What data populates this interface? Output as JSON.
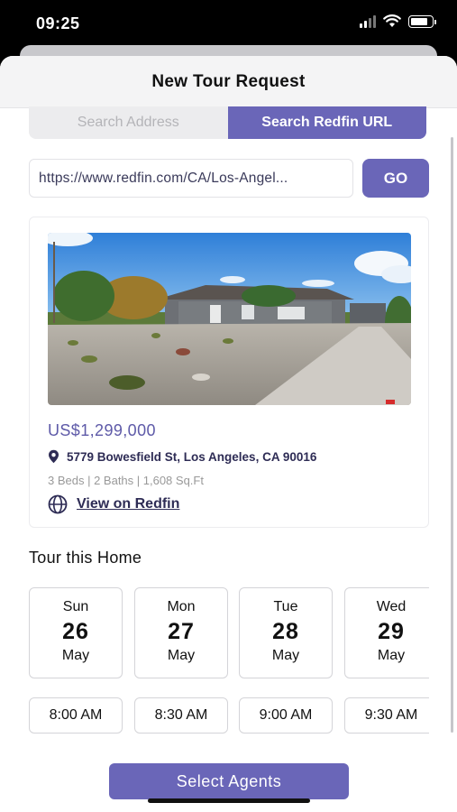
{
  "status_bar": {
    "time": "09:25"
  },
  "header": {
    "title": "New Tour Request"
  },
  "search_tabs": {
    "address_label": "Search Address",
    "redfin_label": "Search Redfin URL",
    "active": "redfin"
  },
  "url_input": {
    "value": "https://www.redfin.com/CA/Los-Angel..."
  },
  "go_button": {
    "label": "GO"
  },
  "listing": {
    "price": "US$1,299,000",
    "address": "5779 Bowesfield St, Los Angeles, CA 90016",
    "specs": "3 Beds | 2 Baths | 1,608 Sq.Ft",
    "link_label": "View on Redfin",
    "photo": "house-exterior-photo"
  },
  "tour": {
    "title": "Tour this Home",
    "dates": [
      {
        "dow": "Sun",
        "day": "26",
        "month": "May"
      },
      {
        "dow": "Mon",
        "day": "27",
        "month": "May"
      },
      {
        "dow": "Tue",
        "day": "28",
        "month": "May"
      },
      {
        "dow": "Wed",
        "day": "29",
        "month": "May"
      }
    ],
    "times": [
      "8:00 AM",
      "8:30 AM",
      "9:00 AM",
      "9:30 AM"
    ]
  },
  "cta": {
    "label": "Select Agents"
  },
  "colors": {
    "accent": "#6a66b8",
    "price": "#5e5aa8",
    "text_dark": "#2e2c55"
  }
}
